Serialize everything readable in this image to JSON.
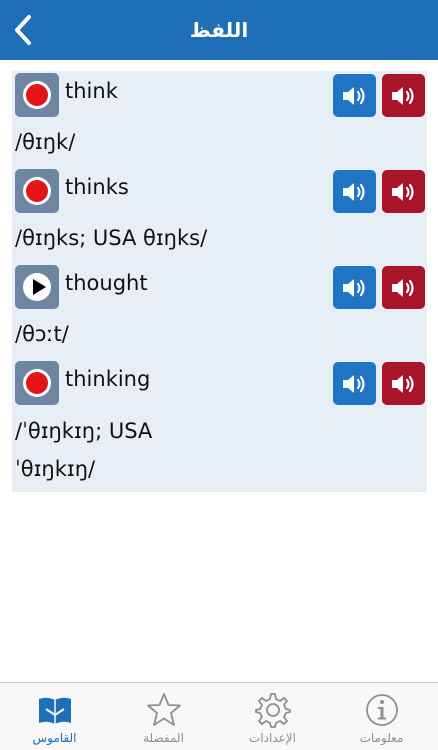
{
  "header": {
    "title": "اللفظ"
  },
  "entries": [
    {
      "word": "think",
      "ipa": "/θɪŋk/",
      "record_state": "record"
    },
    {
      "word": "thinks",
      "ipa": "/θɪŋks; USA θɪŋks/",
      "record_state": "record"
    },
    {
      "word": "thought",
      "ipa": "/θɔːt/",
      "record_state": "play"
    },
    {
      "word": "thinking",
      "ipa": "/ˈθɪŋkɪŋ; USA ˈθɪŋkɪŋ/",
      "record_state": "record"
    }
  ],
  "tabs": [
    {
      "label": "القاموس",
      "icon": "book-icon",
      "active": true
    },
    {
      "label": "المفضلة",
      "icon": "star-icon",
      "active": false
    },
    {
      "label": "الإعدادات",
      "icon": "gear-icon",
      "active": false
    },
    {
      "label": "معلومات",
      "icon": "info-icon",
      "active": false
    }
  ],
  "colors": {
    "header": "#1e6fb8",
    "list_bg": "#e7eef6",
    "record_btn": "#6e85a3",
    "record_dot": "#e3141b",
    "us_speaker": "#1f75c4",
    "uk_speaker": "#a8152a",
    "tab_active": "#1e6fb8",
    "tab_inactive": "#8e8e93"
  }
}
